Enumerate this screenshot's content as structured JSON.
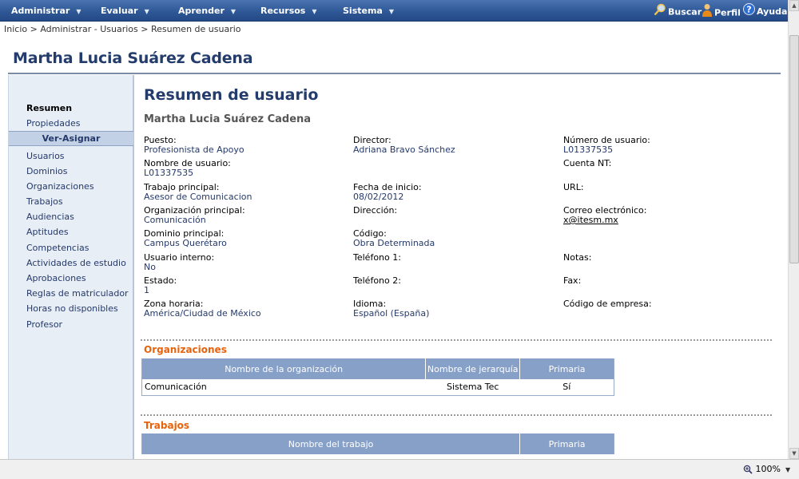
{
  "nav": {
    "menus": [
      {
        "label": "Administrar"
      },
      {
        "label": "Evaluar"
      },
      {
        "label": "Aprender"
      },
      {
        "label": "Recursos"
      },
      {
        "label": "Sistema"
      }
    ],
    "utilities": {
      "search": "Buscar",
      "profile": "Perfil",
      "help": "Ayuda"
    }
  },
  "breadcrumb": "Inicio > Administrar - Usuarios > Resumen de usuario",
  "header": {
    "title": "Martha Lucia Suárez Cadena"
  },
  "sidebar": {
    "top_items": [
      {
        "label": "Resumen"
      },
      {
        "label": "Propiedades"
      }
    ],
    "section_label": "Ver-Asignar",
    "items": [
      {
        "label": "Usuarios"
      },
      {
        "label": "Dominios"
      },
      {
        "label": "Organizaciones"
      },
      {
        "label": "Trabajos"
      },
      {
        "label": "Audiencias"
      },
      {
        "label": "Aptitudes"
      },
      {
        "label": "Competencias"
      },
      {
        "label": "Actividades de estudio"
      },
      {
        "label": "Aprobaciones"
      },
      {
        "label": "Reglas de matriculador"
      },
      {
        "label": "Horas no disponibles"
      },
      {
        "label": "Profesor"
      }
    ]
  },
  "summary": {
    "title": "Resumen de usuario",
    "name": "Martha Lucia Suárez Cadena",
    "fields": [
      {
        "label": "Puesto:",
        "value": "Profesionista de Apoyo"
      },
      {
        "label": "Director:",
        "value": "Adriana Bravo Sánchez"
      },
      {
        "label": "Número de usuario:",
        "value": "L01337535"
      },
      {
        "label": "Nombre de usuario:",
        "value": "L01337535"
      },
      {
        "label": "",
        "value": ""
      },
      {
        "label": "Cuenta NT:",
        "value": ""
      },
      {
        "label": "Trabajo principal:",
        "value": "Asesor de Comunicacion"
      },
      {
        "label": "Fecha de inicio:",
        "value": "08/02/2012"
      },
      {
        "label": "URL:",
        "value": ""
      },
      {
        "label": "Organización principal:",
        "value": "Comunicación"
      },
      {
        "label": "Dirección:",
        "value": ""
      },
      {
        "label": "Correo electrónico:",
        "value": "x@itesm.mx"
      },
      {
        "label": "Dominio principal:",
        "value": "Campus Querétaro"
      },
      {
        "label": "Código:",
        "value": "Obra Determinada"
      },
      {
        "label": "",
        "value": ""
      },
      {
        "label": "Usuario interno:",
        "value": "No"
      },
      {
        "label": "Teléfono 1:",
        "value": ""
      },
      {
        "label": "Notas:",
        "value": ""
      },
      {
        "label": "Estado:",
        "value": "1"
      },
      {
        "label": "Teléfono 2:",
        "value": ""
      },
      {
        "label": "Fax:",
        "value": ""
      },
      {
        "label": "Zona horaria:",
        "value": "América/Ciudad de México"
      },
      {
        "label": "Idioma:",
        "value": "Español (España)"
      },
      {
        "label": "Código de empresa:",
        "value": ""
      }
    ]
  },
  "organizations": {
    "title": "Organizaciones",
    "columns": [
      "Nombre de la organización",
      "Nombre de jerarquía",
      "Primaria"
    ],
    "rows": [
      [
        "Comunicación",
        "Sistema Tec",
        "Sí"
      ]
    ]
  },
  "jobs": {
    "title": "Trabajos",
    "columns": [
      "Nombre del trabajo",
      "Primaria"
    ]
  },
  "statusbar": {
    "zoom": "100%"
  }
}
